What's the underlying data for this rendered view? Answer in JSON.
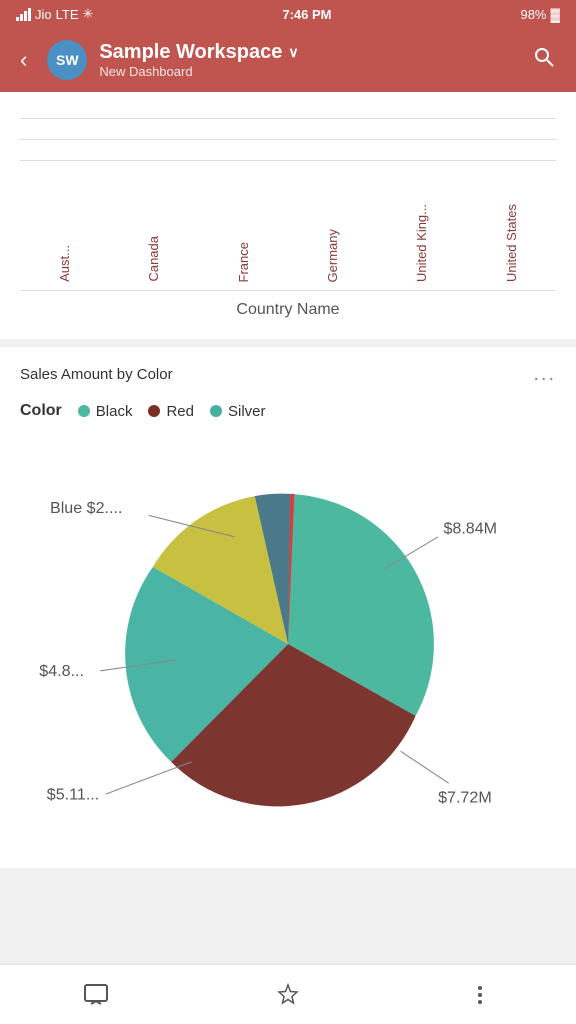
{
  "statusBar": {
    "carrier": "Jio",
    "network": "LTE",
    "time": "7:46 PM",
    "battery": "98%"
  },
  "header": {
    "backLabel": "‹",
    "avatarText": "SW",
    "workspaceName": "Sample Workspace",
    "chevron": "∨",
    "subtitle": "New Dashboard",
    "searchIcon": "🔍"
  },
  "barChart": {
    "countries": [
      "Aust...",
      "Canada",
      "France",
      "Germany",
      "United King...",
      "United States"
    ],
    "xAxisLabel": "Country Name"
  },
  "pieChart": {
    "title": "Sales Amount by Color",
    "moreBtn": "...",
    "legend": {
      "title": "Color",
      "items": [
        {
          "label": "Black",
          "color": "#4db8a0"
        },
        {
          "label": "Red",
          "color": "#7d2d28"
        },
        {
          "label": "Silver",
          "color": "#45b0a0"
        }
      ]
    },
    "segments": [
      {
        "label": "$8.84M",
        "color": "#4db8a0",
        "startAngle": -90,
        "endAngle": 27
      },
      {
        "label": "$7.72M",
        "color": "#7d3530",
        "startAngle": 27,
        "endAngle": 168
      },
      {
        "label": "$5.11...",
        "color": "#4ab5a5",
        "startAngle": 168,
        "endAngle": 248
      },
      {
        "label": "$4.8...",
        "color": "#c8c040",
        "startAngle": 248,
        "endAngle": 305
      },
      {
        "label": "Blue $2....",
        "color": "#4a7a8a",
        "startAngle": 305,
        "endAngle": 345
      },
      {
        "label": "",
        "color": "#d44040",
        "startAngle": 345,
        "endAngle": 360
      }
    ]
  },
  "bottomNav": {
    "chatIcon": "💬",
    "bookmarkIcon": "☆",
    "moreIcon": "⋮"
  }
}
